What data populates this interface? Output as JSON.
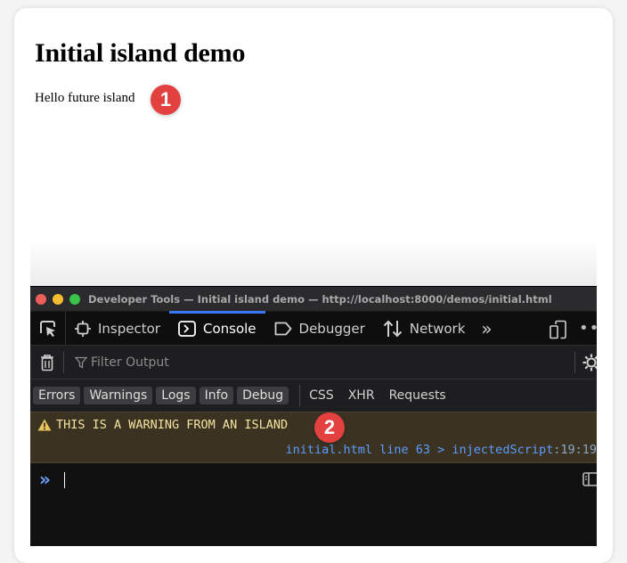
{
  "page": {
    "title": "Initial island demo",
    "text": "Hello future island"
  },
  "annotations": {
    "badge1": "1",
    "badge2": "2"
  },
  "devtools": {
    "window_title": "Developer Tools — Initial island demo — http://localhost:8000/demos/initial.html",
    "tabs": [
      {
        "label": "Inspector",
        "icon": "inspector-icon"
      },
      {
        "label": "Console",
        "icon": "console-icon",
        "active": true
      },
      {
        "label": "Debugger",
        "icon": "debugger-icon"
      },
      {
        "label": "Network",
        "icon": "network-icon"
      }
    ],
    "more_tabs": "»",
    "filter_placeholder": "Filter Output",
    "levels": [
      "Errors",
      "Warnings",
      "Logs",
      "Info",
      "Debug"
    ],
    "requests": [
      "CSS",
      "XHR",
      "Requests"
    ],
    "message": {
      "level": "warning",
      "text": "THIS IS A WARNING FROM AN ISLAND",
      "location_file": "initial.html line 63 > injectedScript",
      "location_pos": ":19:19"
    },
    "prompt_symbol": "»",
    "colors": {
      "accent": "#3b78ff",
      "warning_bg": "#3b3222",
      "warning_text": "#f5e3a0",
      "link": "#5b9cff",
      "badge": "#e34040"
    }
  }
}
